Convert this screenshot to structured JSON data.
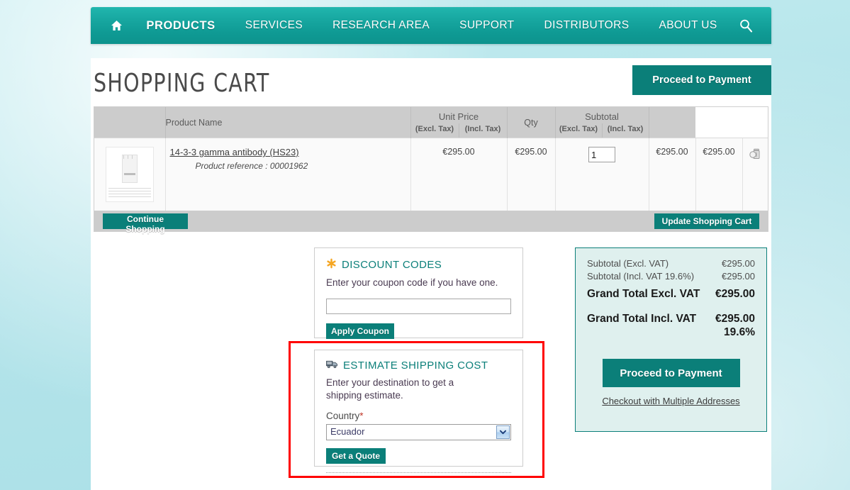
{
  "nav": {
    "home_icon": "home-icon",
    "search_icon": "search-icon",
    "items": [
      {
        "label": "PRODUCTS",
        "active": true
      },
      {
        "label": "SERVICES",
        "active": false
      },
      {
        "label": "RESEARCH AREA",
        "active": false
      },
      {
        "label": "SUPPORT",
        "active": false
      },
      {
        "label": "DISTRIBUTORS",
        "active": false
      },
      {
        "label": "ABOUT US",
        "active": false
      }
    ]
  },
  "header": {
    "title": "SHOPPING CART",
    "proceed_label": "Proceed to Payment"
  },
  "cart": {
    "columns": {
      "product_name": "Product Name",
      "unit_price": "Unit Price",
      "qty": "Qty",
      "subtotal": "Subtotal",
      "excl_tax": "(Excl. Tax)",
      "incl_tax": "(Incl. Tax)"
    },
    "rows": [
      {
        "name": "14-3-3 gamma antibody (HS23)",
        "reference": "Product reference : 00001962",
        "unit_price_excl": "€295.00",
        "unit_price_incl": "€295.00",
        "qty": "1",
        "subtotal_excl": "€295.00",
        "subtotal_incl": "€295.00",
        "delete_icon": "trash-icon"
      }
    ],
    "continue_label": "Continue Shopping",
    "update_label": "Update Shopping Cart"
  },
  "discount": {
    "icon": "asterisk-icon",
    "title": "DISCOUNT CODES",
    "description": "Enter your coupon code if you have one.",
    "input_value": "",
    "input_placeholder": "",
    "apply_label": "Apply Coupon"
  },
  "shipping": {
    "icon": "truck-icon",
    "title": "ESTIMATE SHIPPING COST",
    "description": "Enter your destination to get a shipping estimate.",
    "country_label": "Country",
    "required_mark": "*",
    "country_value": "Ecuador",
    "quote_label": "Get a Quote"
  },
  "totals": {
    "rows": [
      {
        "label": "Subtotal (Excl. VAT)",
        "value": "€295.00",
        "emphasis": "small"
      },
      {
        "label": "Subtotal (Incl. VAT 19.6%)",
        "value": "€295.00",
        "emphasis": "small"
      },
      {
        "label": "Grand Total Excl. VAT",
        "value": "€295.00",
        "emphasis": "big"
      },
      {
        "label": "Grand Total Incl. VAT",
        "value": "€295.00",
        "emphasis": "big"
      }
    ],
    "vat_rate": "19.6%",
    "proceed_label": "Proceed to Payment",
    "multi_address_label": "Checkout with Multiple Addresses"
  },
  "colors": {
    "teal_button": "#0b7f79",
    "nav_teal": "#17a7a0",
    "page_background": "#b6e6ec",
    "totals_background": "#dff0ee",
    "highlight_red": "#ff0000",
    "table_header_grey": "#cccccc",
    "accent_orange": "#f5a623"
  }
}
